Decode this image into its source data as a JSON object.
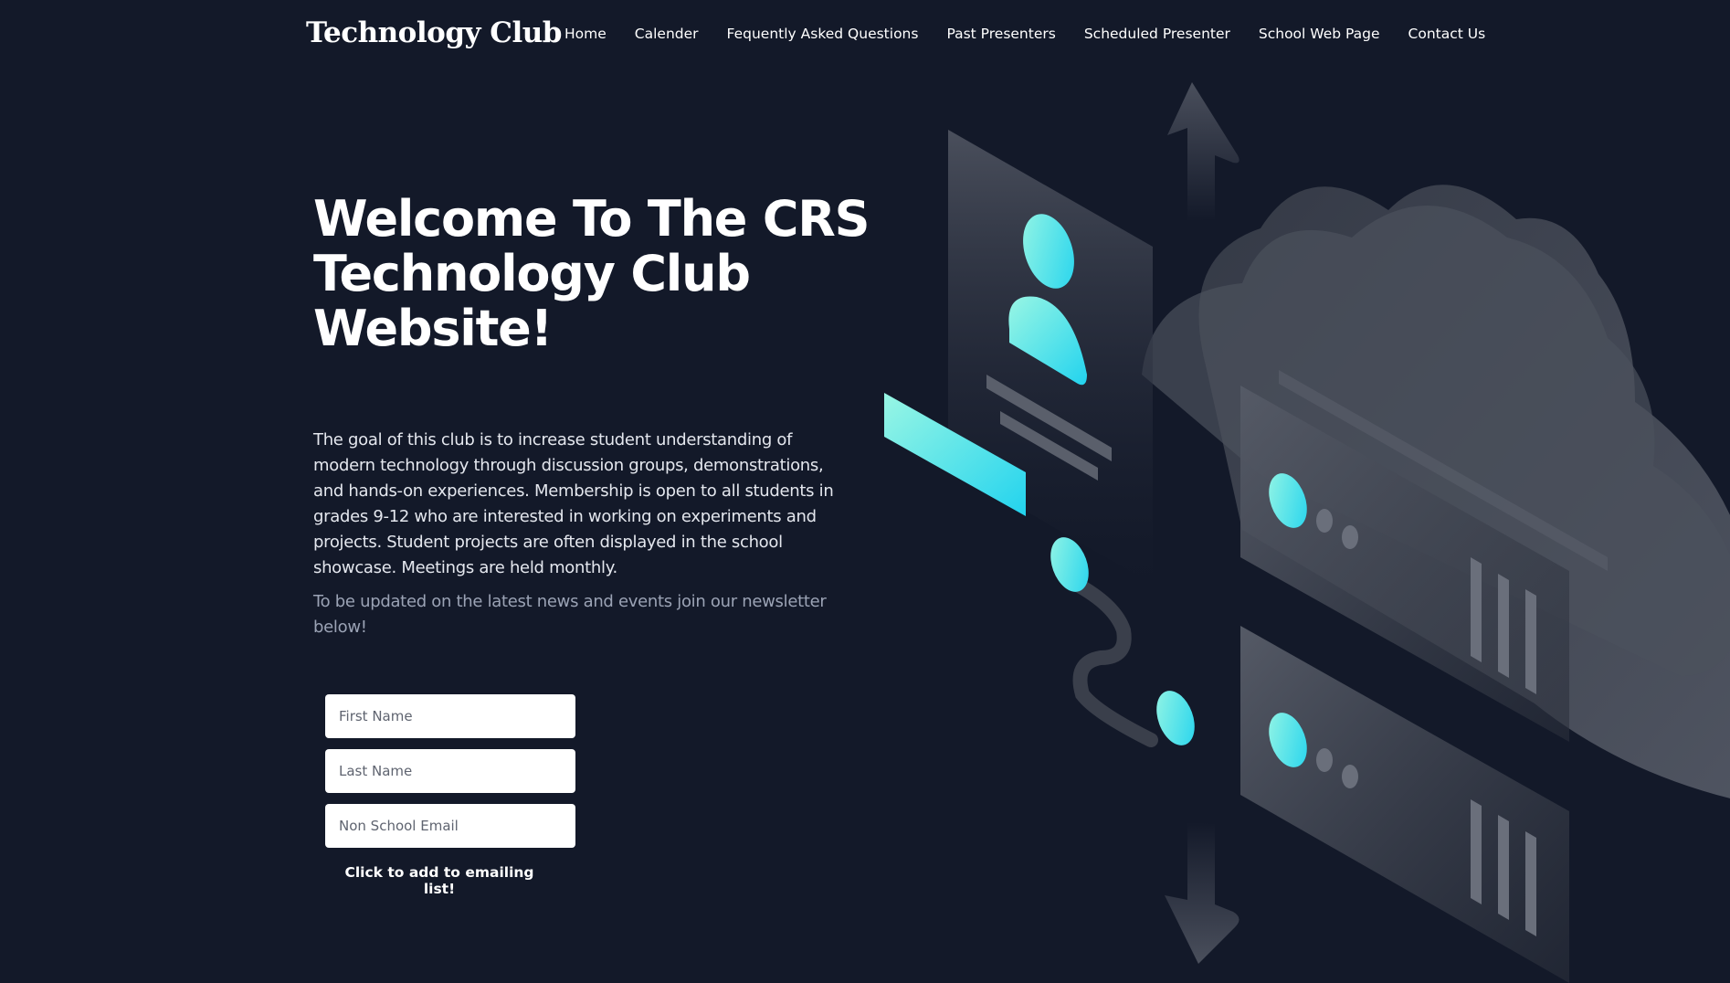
{
  "header": {
    "logo": "Technology Club",
    "nav": [
      {
        "label": "Home"
      },
      {
        "label": "Calender"
      },
      {
        "label": "Fequently Asked Questions"
      },
      {
        "label": "Past Presenters"
      },
      {
        "label": "Scheduled Presenter"
      },
      {
        "label": "School Web Page"
      },
      {
        "label": "Contact Us"
      }
    ]
  },
  "hero": {
    "title": "Welcome To The CRS Technology Club Website!",
    "description": "The goal of this club is to increase student understanding of modern technology through discussion groups, demonstrations, and hands-on experiences. Membership is open to all students in grades 9-12 who are interested in working on experiments and projects. Student projects are often displayed in the school showcase. Meetings are held monthly.",
    "newsletter_prompt": "To be updated on the latest news and events join our newsletter below!"
  },
  "form": {
    "first_name_placeholder": "First Name",
    "last_name_placeholder": "Last Name",
    "email_placeholder": "Non School Email",
    "submit_label": "Click to add to emailing list!"
  },
  "colors": {
    "background": "#131929",
    "accent_cyan": "#22d3ee",
    "accent_light": "#99f6e4",
    "shape_gray": "#4a4f5c"
  },
  "illustration": {
    "icons": [
      "up-arrow-icon",
      "down-arrow-icon",
      "user-icon",
      "server-icon",
      "cloud-icon",
      "cable-icon"
    ]
  }
}
